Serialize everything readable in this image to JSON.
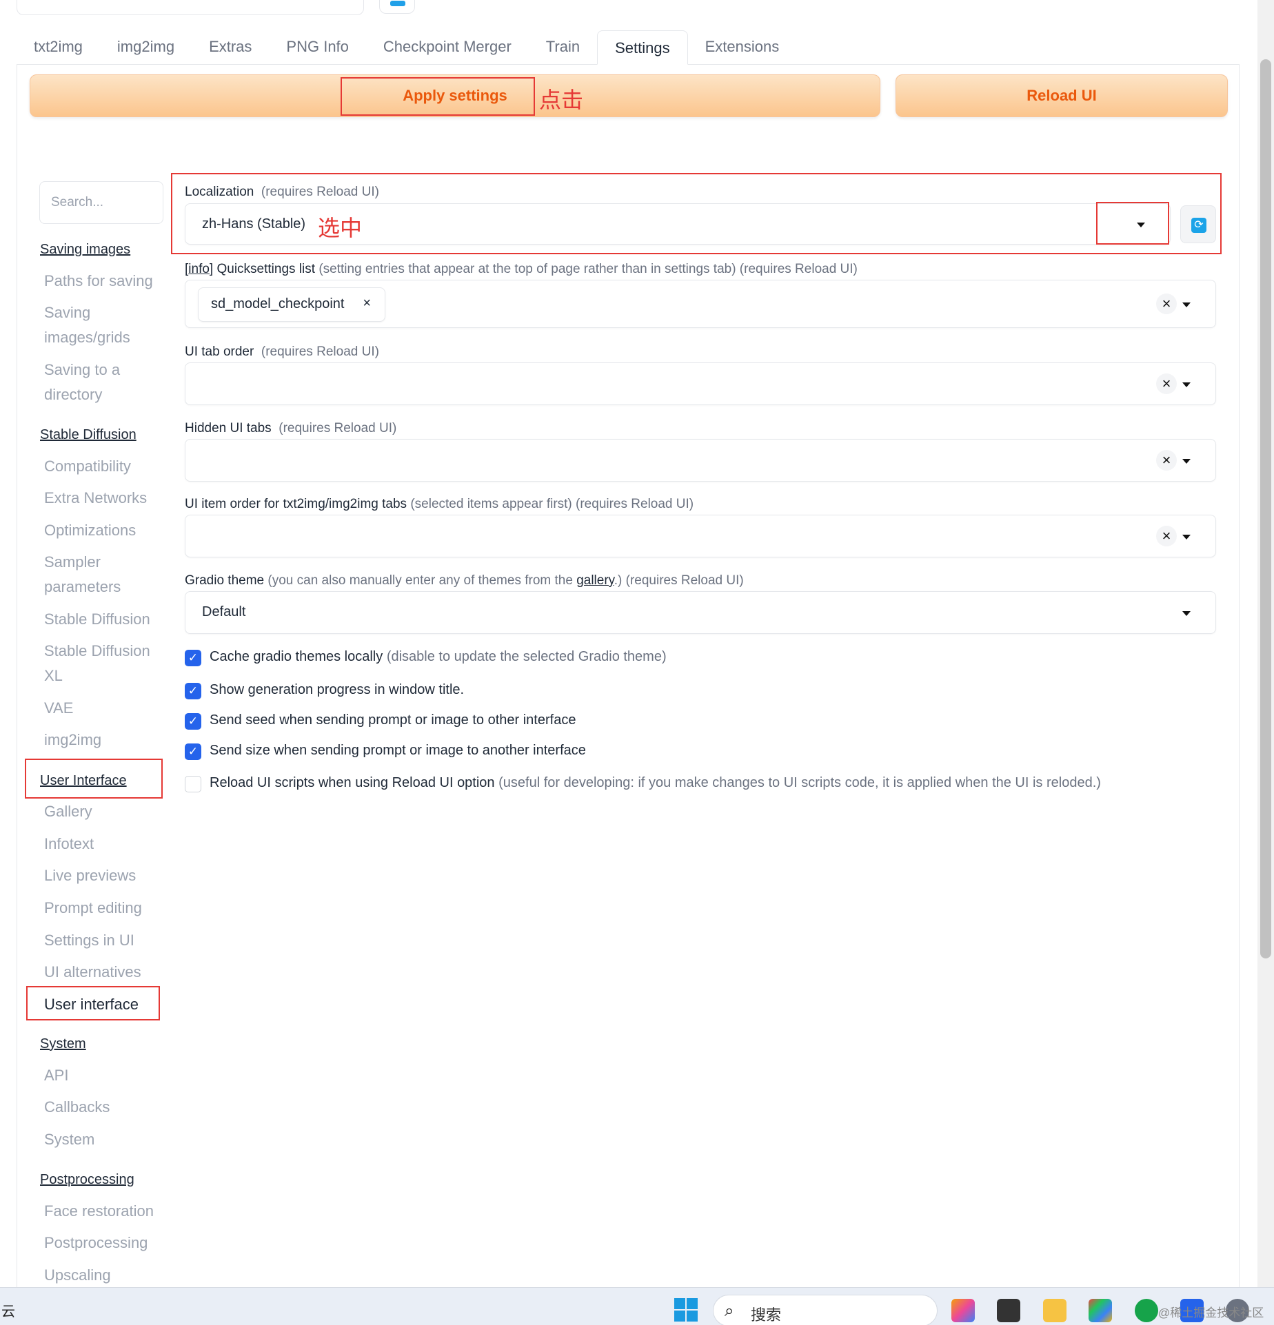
{
  "tabs": [
    "txt2img",
    "img2img",
    "Extras",
    "PNG Info",
    "Checkpoint Merger",
    "Train",
    "Settings",
    "Extensions"
  ],
  "active_tab": "Settings",
  "buttons": {
    "apply": "Apply settings",
    "reload": "Reload UI"
  },
  "annotations": {
    "click": "点击",
    "selected": "选中"
  },
  "sidebar": {
    "search_placeholder": "Search...",
    "sections": [
      {
        "title": "Saving images",
        "items": [
          "Paths for saving",
          "Saving images/grids",
          "Saving to a directory"
        ]
      },
      {
        "title": "Stable Diffusion",
        "items": [
          "Compatibility",
          "Extra Networks",
          "Optimizations",
          "Sampler parameters",
          "Stable Diffusion",
          "Stable Diffusion XL",
          "VAE",
          "img2img"
        ]
      },
      {
        "title": "User Interface",
        "items": [
          "Gallery",
          "Infotext",
          "Live previews",
          "Prompt editing",
          "Settings in UI",
          "UI alternatives",
          "User interface"
        ]
      },
      {
        "title": "System",
        "items": [
          "API",
          "Callbacks",
          "System"
        ]
      },
      {
        "title": "Postprocessing",
        "items": [
          "Face restoration",
          "Postprocessing",
          "Upscaling"
        ]
      }
    ]
  },
  "settings": {
    "localization": {
      "label": "Localization",
      "note": "(requires Reload UI)",
      "value": "zh-Hans (Stable)"
    },
    "quicksettings": {
      "info": "info",
      "label": "Quicksettings list",
      "note": "(setting entries that appear at the top of page rather than in settings tab) (requires Reload UI)",
      "chip": "sd_model_checkpoint"
    },
    "ui_tab_order": {
      "label": "UI tab order",
      "note": "(requires Reload UI)"
    },
    "hidden_ui_tabs": {
      "label": "Hidden UI tabs",
      "note": "(requires Reload UI)"
    },
    "ui_item_order": {
      "label": "UI item order for txt2img/img2img tabs",
      "note": "(selected items appear first) (requires Reload UI)"
    },
    "gradio_theme": {
      "label": "Gradio theme",
      "note_a": "(you can also manually enter any of themes from the ",
      "link": "gallery",
      "note_b": ".) (requires Reload UI)",
      "value": "Default"
    },
    "checkboxes": [
      {
        "label": "Cache gradio themes locally",
        "note": "(disable to update the selected Gradio theme)",
        "checked": true
      },
      {
        "label": "Show generation progress in window title.",
        "note": "",
        "checked": true
      },
      {
        "label": "Send seed when sending prompt or image to other interface",
        "note": "",
        "checked": true
      },
      {
        "label": "Send size when sending prompt or image to another interface",
        "note": "",
        "checked": true
      },
      {
        "label": "Reload UI scripts when using Reload UI option",
        "note": "(useful for developing: if you make changes to UI scripts code, it is applied when the UI is reloded.)",
        "checked": false
      }
    ]
  },
  "taskbar": {
    "left_char": "云",
    "search": "搜索",
    "watermark": "@稀土掘金技术社区"
  },
  "colors": {
    "accent_orange": "#ea580c",
    "annotation_red": "#e53935",
    "checkbox_blue": "#2563eb"
  }
}
